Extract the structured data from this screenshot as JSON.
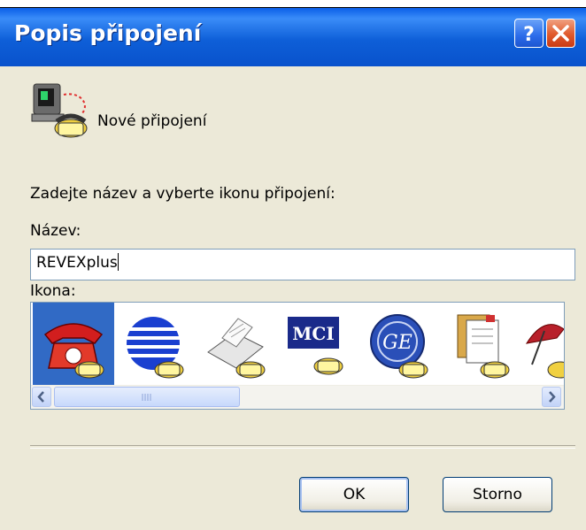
{
  "window": {
    "title": "Popis připojení"
  },
  "connection_name": "Nové připojení",
  "prompt": "Zadejte název a vyberte ikonu připojení:",
  "name_field": {
    "label": "Název:",
    "value": "REVEXplus"
  },
  "icon_field": {
    "label": "Ikona:",
    "selected_index": 0,
    "icons": [
      "red-telephone-icon",
      "globe-network-icon",
      "fax-machine-icon",
      "mci-icon",
      "ge-logo-icon",
      "documents-icon",
      "umbrella-icon"
    ],
    "scroll_position": "left"
  },
  "buttons": {
    "ok": "OK",
    "cancel": "Storno"
  },
  "colors": {
    "titlebar": "#0a5ee8",
    "selection": "#316ac5",
    "dialog_bg": "#ece9d8"
  }
}
